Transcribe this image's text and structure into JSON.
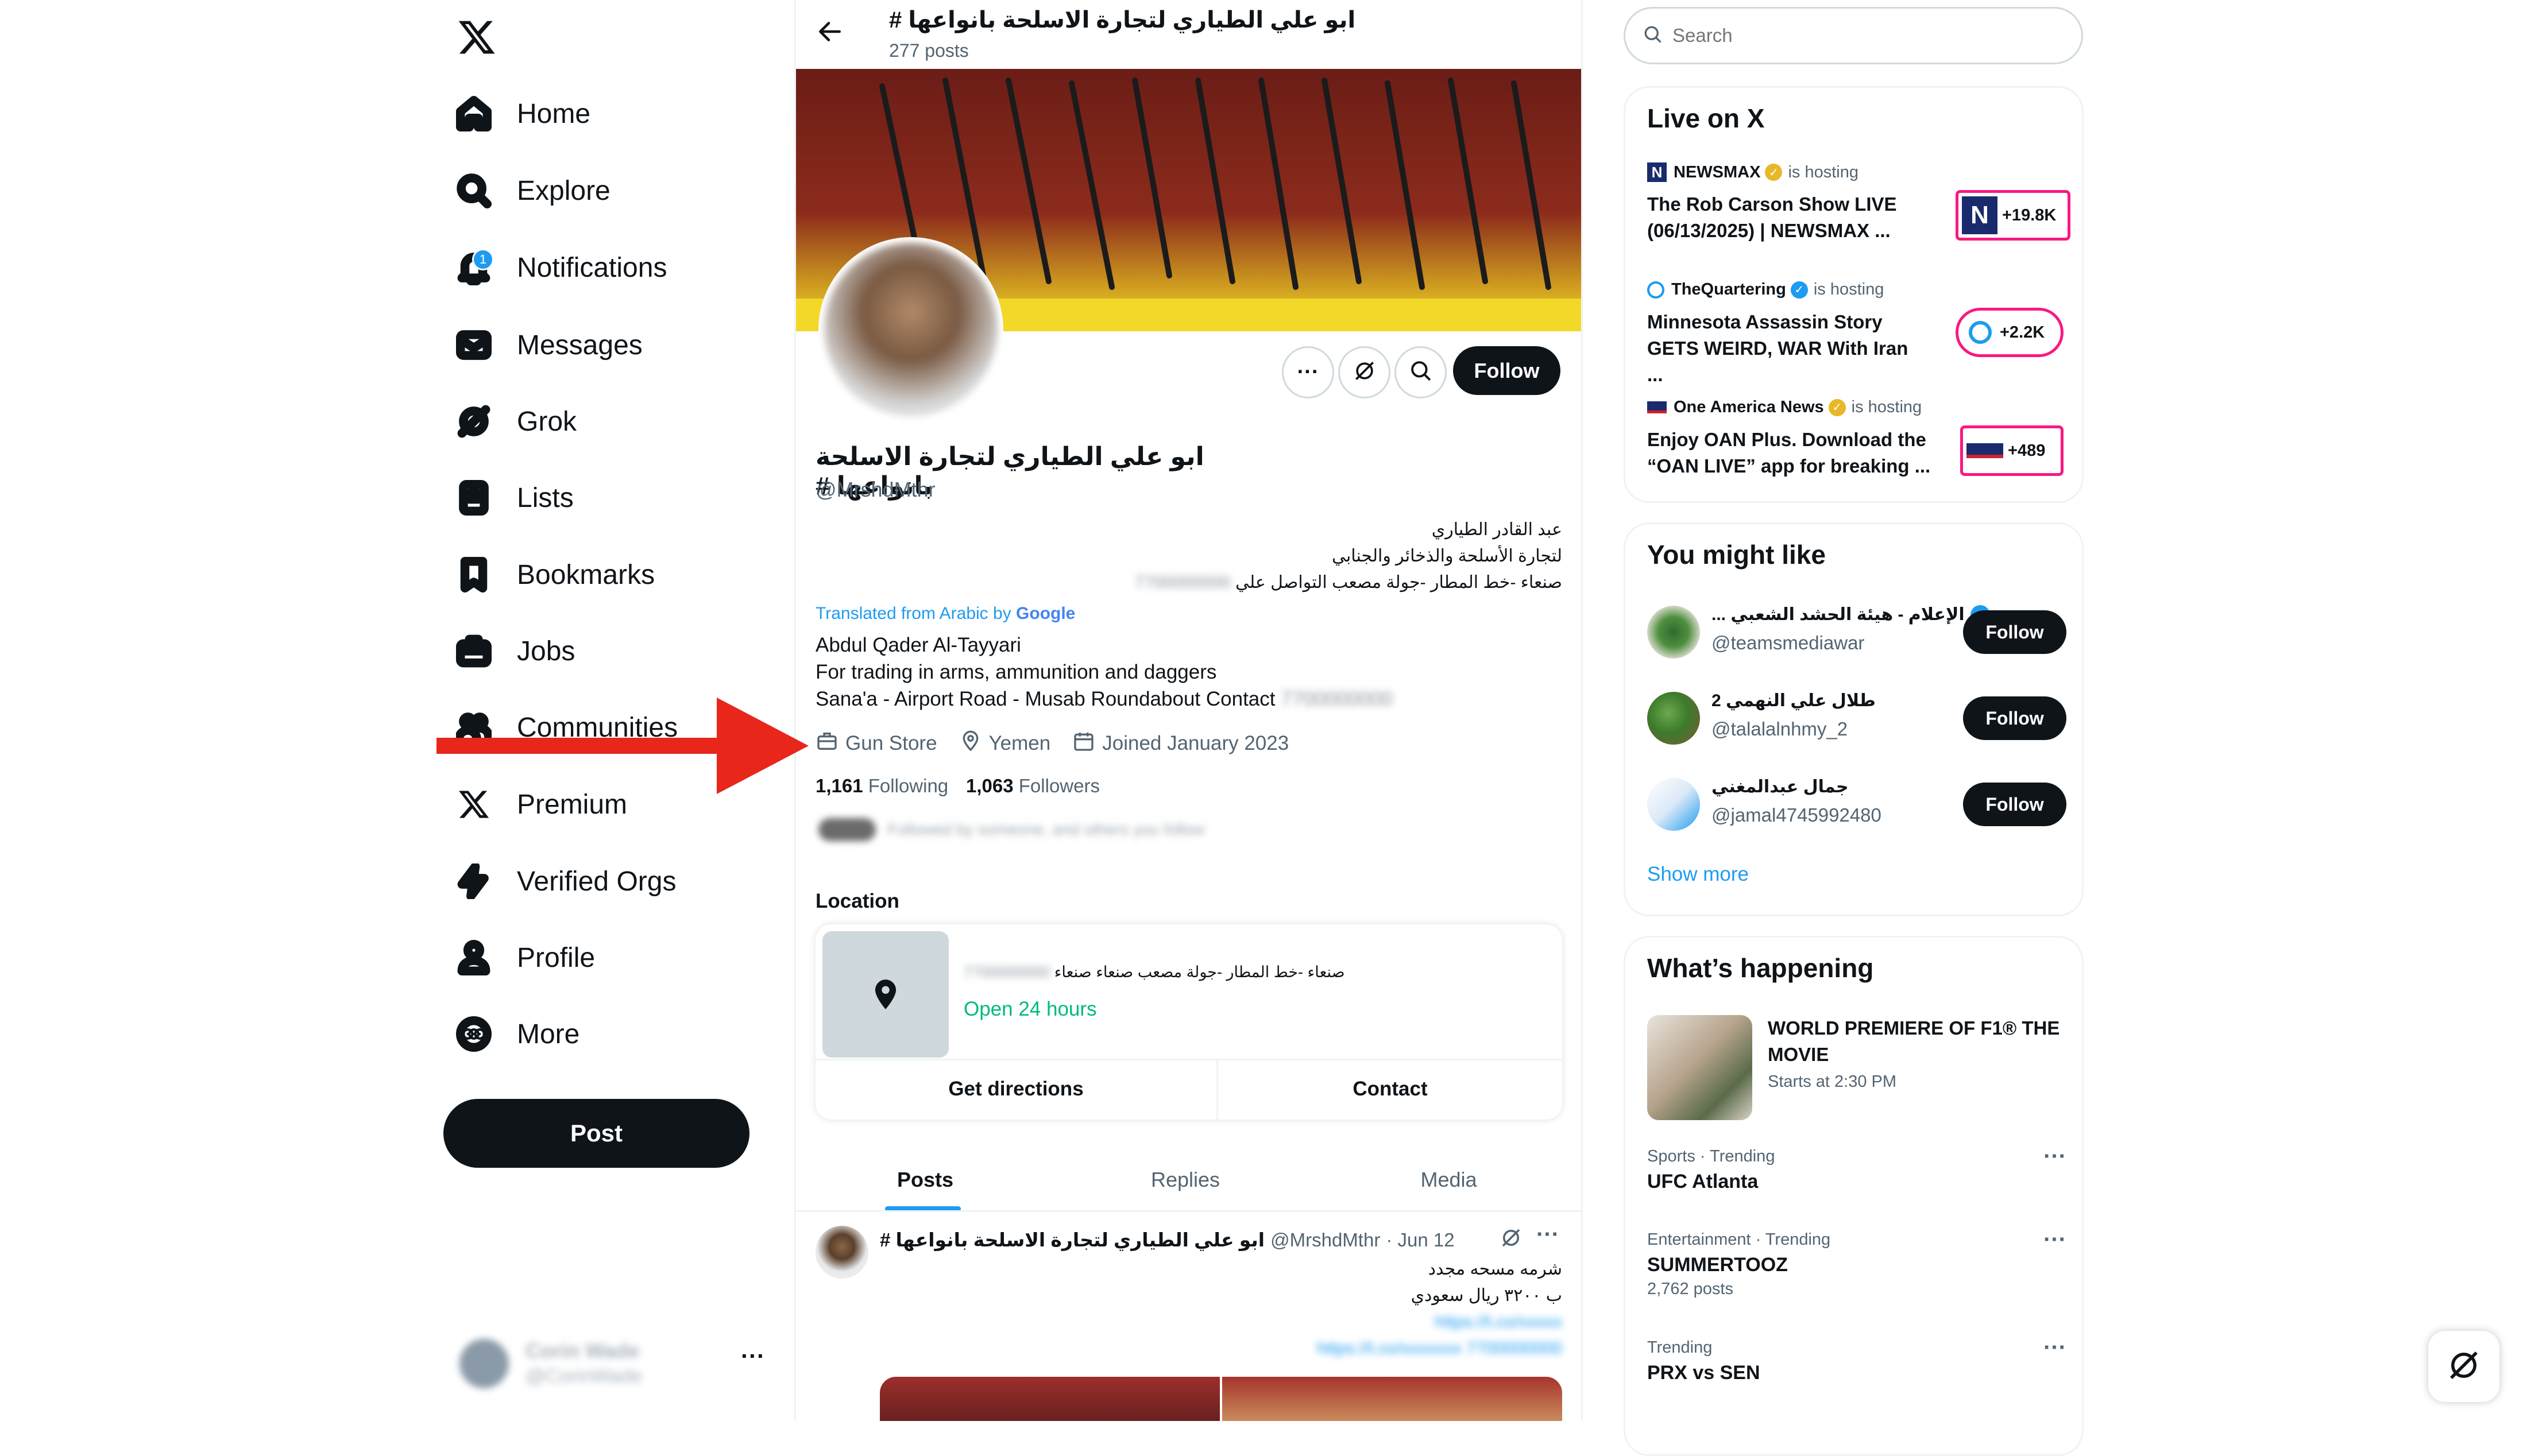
{
  "nav": {
    "items": [
      {
        "label": "Home",
        "icon": "home-icon"
      },
      {
        "label": "Explore",
        "icon": "search-icon"
      },
      {
        "label": "Notifications",
        "icon": "bell-icon",
        "badge": "1"
      },
      {
        "label": "Messages",
        "icon": "mail-icon"
      },
      {
        "label": "Grok",
        "icon": "grok-icon"
      },
      {
        "label": "Lists",
        "icon": "list-icon"
      },
      {
        "label": "Bookmarks",
        "icon": "bookmark-icon"
      },
      {
        "label": "Jobs",
        "icon": "briefcase-icon"
      },
      {
        "label": "Communities",
        "icon": "people-icon"
      },
      {
        "label": "Premium",
        "icon": "x-logo-icon"
      },
      {
        "label": "Verified Orgs",
        "icon": "lightning-icon"
      },
      {
        "label": "Profile",
        "icon": "person-icon"
      },
      {
        "label": "More",
        "icon": "more-circle-icon"
      }
    ],
    "post_label": "Post",
    "account_name": "Corin Wade",
    "account_handle": "@CorinWade"
  },
  "header": {
    "title": "ابو علي الطياري لتجارة الاسلحة بانواعها #",
    "posts_count": "277 posts"
  },
  "profile": {
    "name": "ابو علي الطياري لتجارة الاسلحة بانواعها #",
    "handle": "@MrshdMthr",
    "follow_label": "Follow",
    "bio_ar": [
      "عبد القادر الطياري",
      "لتجارة الأسلحة والذخائر والجنابي",
      "صنعاء -خط المطار -جولة مصعب التواصل علي"
    ],
    "bio_ar_blurred": "7700000000",
    "translated_prefix": "Translated from Arabic by ",
    "translated_brand": "Google",
    "bio_en": [
      "Abdul Qader Al-Tayyari",
      "For trading in arms, ammunition and daggers",
      "Sana'a - Airport Road - Musab Roundabout Contact"
    ],
    "bio_en_blurred": "7700000000",
    "category": "Gun Store",
    "location": "Yemen",
    "joined": "Joined January 2023",
    "following_count": "1,161",
    "following_label": "Following",
    "followers_count": "1,063",
    "followers_label": "Followers",
    "followed_by_blurred": "Followed by someone, and others you follow",
    "location_heading": "Location",
    "address_ar": "صنعاء -خط المطار -جولة مصعب صنعاء صنعاء",
    "address_blurred": "7700000000",
    "hours": "Open 24 hours",
    "get_directions": "Get directions",
    "contact": "Contact"
  },
  "tabs": [
    {
      "label": "Posts",
      "active": true
    },
    {
      "label": "Replies",
      "active": false
    },
    {
      "label": "Media",
      "active": false
    }
  ],
  "post": {
    "name": "ابو علي الطياري لتجارة الاسلحة بانواعها #",
    "handle": "@MrshdMthr",
    "date": "· Jun 12",
    "line1": "شرمه مسحه مجدد",
    "line2": "ب ٣٢٠٠ ريال سعودي",
    "link1_blurred": "https://t.co/xxxxx",
    "link2_blurred": "https://t.co/xxxxxxx 7700000000"
  },
  "search": {
    "placeholder": "Search"
  },
  "live": {
    "title": "Live on X",
    "items": [
      {
        "host": "NEWSMAX",
        "badge_color": "#e8b829",
        "hosting": "is hosting",
        "title": "The Rob Carson Show LIVE (06/13/2025) | NEWSMAX ...",
        "count": "+19.8K"
      },
      {
        "host": "TheQuartering",
        "badge_color": "#1d9bf0",
        "hosting": "is hosting",
        "title": "Minnesota Assassin Story GETS WEIRD, WAR With Iran ...",
        "count": "+2.2K"
      },
      {
        "host": "One America News",
        "badge_color": "#e8b829",
        "hosting": "is hosting",
        "title": "Enjoy OAN Plus. Download the “OAN LIVE” app for breaking ...",
        "count": "+489"
      }
    ]
  },
  "might_like": {
    "title": "You might like",
    "items": [
      {
        "name": "الإعلام - هيئة الحشد الشعبي ...",
        "handle": "@teamsmediawar",
        "verified": true,
        "follow": "Follow"
      },
      {
        "name": "طلال علي النهمي 2",
        "handle": "@talalalnhmy_2",
        "verified": false,
        "follow": "Follow"
      },
      {
        "name": "جمال عبدالمغني",
        "handle": "@jamal4745992480",
        "verified": false,
        "follow": "Follow"
      }
    ],
    "show_more": "Show more"
  },
  "happening": {
    "title": "What’s happening",
    "featured_title": "WORLD PREMIERE OF F1® THE MOVIE",
    "featured_sub": "Starts at 2:30 PM",
    "trends": [
      {
        "meta": "Sports · Trending",
        "name": "UFC Atlanta",
        "posts": ""
      },
      {
        "meta": "Entertainment · Trending",
        "name": "SUMMERTOOZ",
        "posts": "2,762 posts"
      },
      {
        "meta": "Trending",
        "name": "PRX vs SEN",
        "posts": ""
      }
    ]
  },
  "colors": {
    "accent": "#1d9bf0",
    "dark": "#0f1419",
    "muted": "#536471",
    "arrow": "#e8261a",
    "open_green": "#00ba7c",
    "live_pink": "#f91880"
  }
}
